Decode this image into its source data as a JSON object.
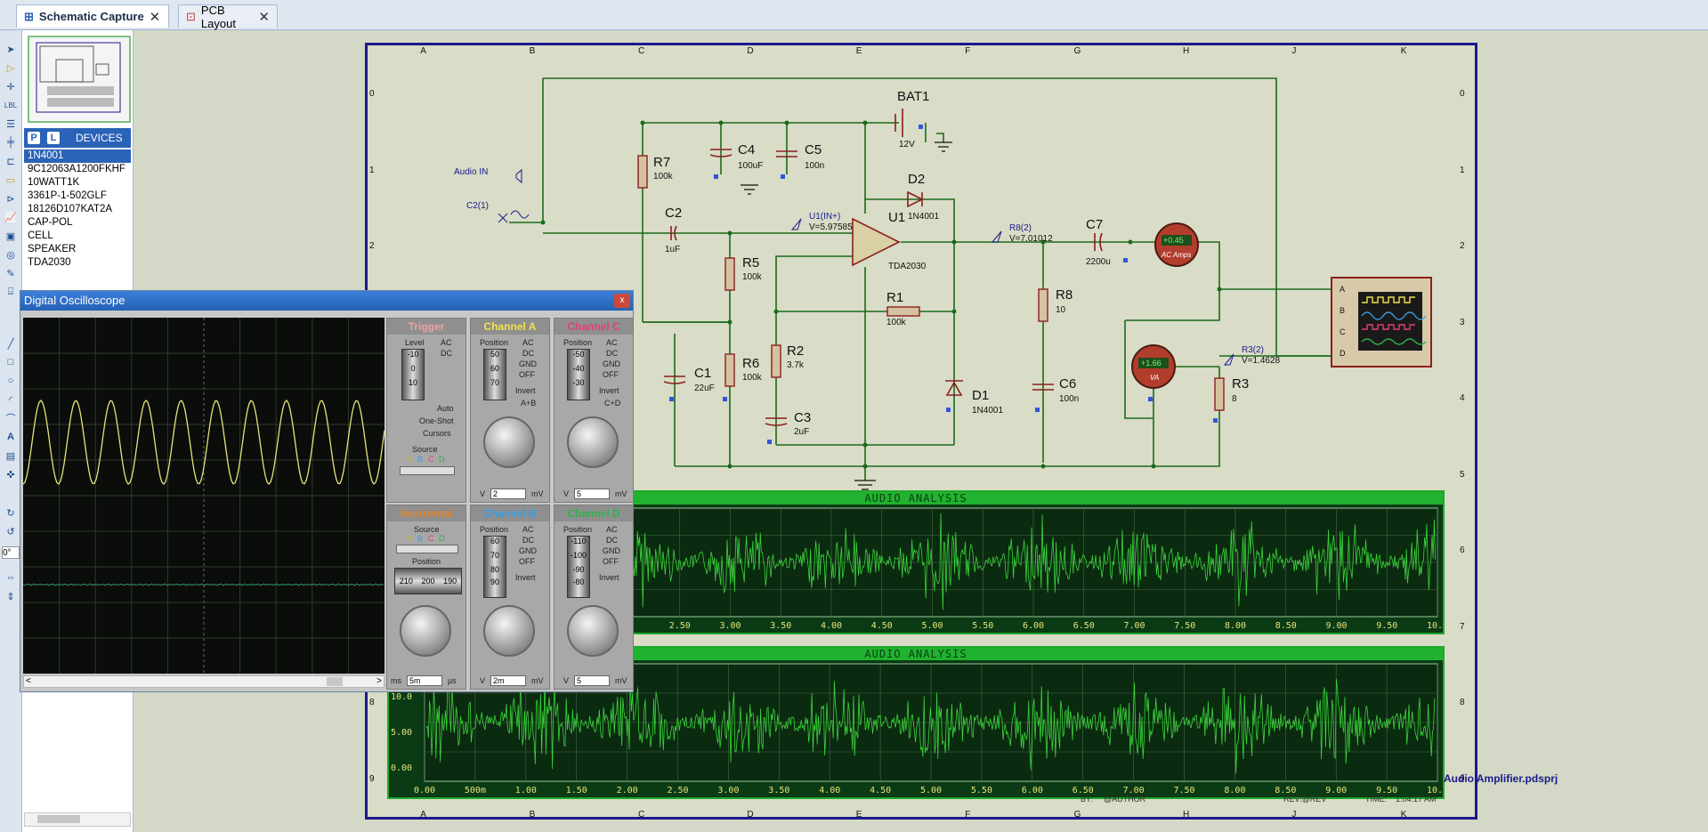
{
  "tabs": [
    {
      "label": "Schematic Capture",
      "active": true
    },
    {
      "label": "PCB Layout",
      "active": false
    }
  ],
  "devices": {
    "header": "DEVICES",
    "p_label": "P",
    "l_label": "L",
    "items": [
      "1N4001",
      "9C12063A1200FKHF",
      "10WATT1K",
      "3361P-1-502GLF",
      "18126D107KAT2A",
      "CAP-POL",
      "CELL",
      "SPEAKER",
      "TDA2030"
    ],
    "selected": 0
  },
  "rotation": "0°",
  "sheet": {
    "columns": [
      "A",
      "B",
      "C",
      "D",
      "E",
      "F",
      "G",
      "H",
      "J",
      "K"
    ],
    "rows": [
      "0",
      "1",
      "2",
      "3",
      "4",
      "5",
      "6",
      "7",
      "8",
      "9"
    ],
    "project_file": "Audio Amplifier.pdsprj",
    "title_by": "BY:",
    "title_author": "@AUTHOR",
    "title_rev": "REV:@REV",
    "title_time": "TIME:",
    "title_time_value": "1:04:17 AM"
  },
  "schematic": {
    "components": [
      {
        "id": "BAT1",
        "value": "12V"
      },
      {
        "id": "R7",
        "value": "100k"
      },
      {
        "id": "C4",
        "value": "100uF"
      },
      {
        "id": "C5",
        "value": "100n"
      },
      {
        "id": "D2",
        "value": "1N4001"
      },
      {
        "id": "C2",
        "value": "1uF"
      },
      {
        "id": "U1",
        "value": "TDA2030"
      },
      {
        "id": "R5",
        "value": "100k"
      },
      {
        "id": "R1",
        "value": "100k"
      },
      {
        "id": "R6",
        "value": "100k"
      },
      {
        "id": "R2",
        "value": "3.7k"
      },
      {
        "id": "C1",
        "value": "22uF"
      },
      {
        "id": "C3",
        "value": "2uF"
      },
      {
        "id": "D1",
        "value": "1N4001"
      },
      {
        "id": "R8",
        "value": "10"
      },
      {
        "id": "C6",
        "value": "100n"
      },
      {
        "id": "C7",
        "value": "2200u"
      },
      {
        "id": "R3",
        "value": "8"
      }
    ],
    "audio_in": "Audio IN",
    "c2_label": "C2(1)",
    "probe_u1": "U1(IN+)",
    "probe_u1_v": "V=5.97585",
    "probe_r8": "R8(2)",
    "probe_r8_v": "V=7.01012",
    "probe_r3": "R3(2)",
    "probe_r3_v": "V=1.4628",
    "ac_amps_reading": "+0.45",
    "ac_amps_label": "AC Amps",
    "va_reading": "+1.66",
    "va_label": "VA",
    "scope_channels": [
      "A",
      "B",
      "C",
      "D"
    ]
  },
  "oscilloscope": {
    "title": "Digital Oscilloscope",
    "close": "x",
    "trigger": {
      "title": "Trigger",
      "level": "Level",
      "ac": "AC",
      "dc": "DC",
      "auto": "Auto",
      "one_shot": "One-Shot",
      "cursors": "Cursors",
      "source": "Source",
      "source_opts": [
        "A",
        "B",
        "C",
        "D"
      ],
      "dial": [
        "-10",
        "0",
        "10"
      ]
    },
    "channel_a": {
      "title": "Channel A",
      "position": "Position",
      "opts": [
        "AC",
        "DC",
        "GND",
        "OFF"
      ],
      "invert": "Invert",
      "ab": "A+B",
      "dial": [
        "50",
        "60",
        "70"
      ],
      "unit_v": "V",
      "value": "2",
      "unit": "mV",
      "color": "#f1e24b"
    },
    "channel_c": {
      "title": "Channel C",
      "position": "Position",
      "opts": [
        "AC",
        "DC",
        "GND",
        "OFF"
      ],
      "invert": "Invert",
      "cd": "C+D",
      "dial": [
        "-50",
        "-40",
        "-30"
      ],
      "unit_v": "V",
      "value": "5",
      "unit": "mV",
      "color": "#e0407a"
    },
    "horizontal": {
      "title": "Horizontal",
      "source": "Source",
      "source_opts": [
        "A",
        "B",
        "C",
        "D"
      ],
      "position": "Position",
      "dial": [
        "210",
        "200",
        "190"
      ],
      "unit_ms": "ms",
      "value": "5m",
      "unit": "µs",
      "color": "#e0842a"
    },
    "channel_b": {
      "title": "Channel B",
      "position": "Position",
      "opts": [
        "AC",
        "DC",
        "GND",
        "OFF"
      ],
      "invert": "Invert",
      "dial": [
        "60",
        "70",
        "80",
        "90"
      ],
      "unit_v": "V",
      "value": "2m",
      "unit": "mV",
      "color": "#3a9de0"
    },
    "channel_d": {
      "title": "Channel D",
      "position": "Position",
      "opts": [
        "AC",
        "DC",
        "GND",
        "OFF"
      ],
      "invert": "Invert",
      "dial": [
        "-110",
        "-100",
        "-90",
        "-80"
      ],
      "unit_v": "V",
      "value": "5",
      "unit": "mV",
      "color": "#2fb24c"
    },
    "scroll_left": "<",
    "scroll_right": ">"
  },
  "audio_analysis": {
    "title": "AUDIO ANALYSIS",
    "x_ticks_top": [
      "2.50",
      "3.00",
      "3.50",
      "4.00",
      "4.50",
      "5.00",
      "5.50",
      "6.00",
      "6.50",
      "7.00",
      "7.50",
      "8.00",
      "8.50",
      "9.00",
      "9.50",
      "10.0"
    ],
    "x_ticks_bottom": [
      "0.00",
      "500m",
      "1.00",
      "1.50",
      "2.00",
      "2.50",
      "3.00",
      "3.50",
      "4.00",
      "4.50",
      "5.00",
      "5.50",
      "6.00",
      "6.50",
      "7.00",
      "7.50",
      "8.00",
      "8.50",
      "9.00",
      "9.50",
      "10.0"
    ],
    "y_ticks_bottom": [
      "10.0",
      "5.00",
      "0.00"
    ]
  },
  "colors": {
    "accent": "#2a63b7",
    "trace_yellow": "#e8e27a",
    "trace_green": "#3bd43b",
    "wire": "#1a6b1a"
  }
}
